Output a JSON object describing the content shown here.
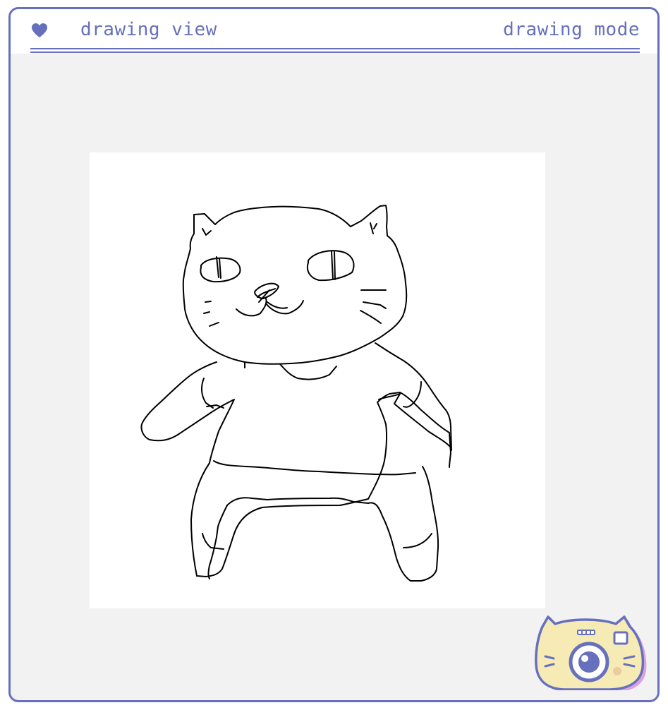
{
  "header": {
    "title": "drawing view",
    "mode_label": "drawing mode"
  },
  "icons": {
    "heart": "heart-icon",
    "camera": "cat-camera-icon"
  },
  "colors": {
    "accent": "#6670bd",
    "background": "#f2f2f2",
    "canvas": "#ffffff",
    "camera_fill": "#f7ebb5",
    "camera_shadow": "#d9a3e0"
  }
}
